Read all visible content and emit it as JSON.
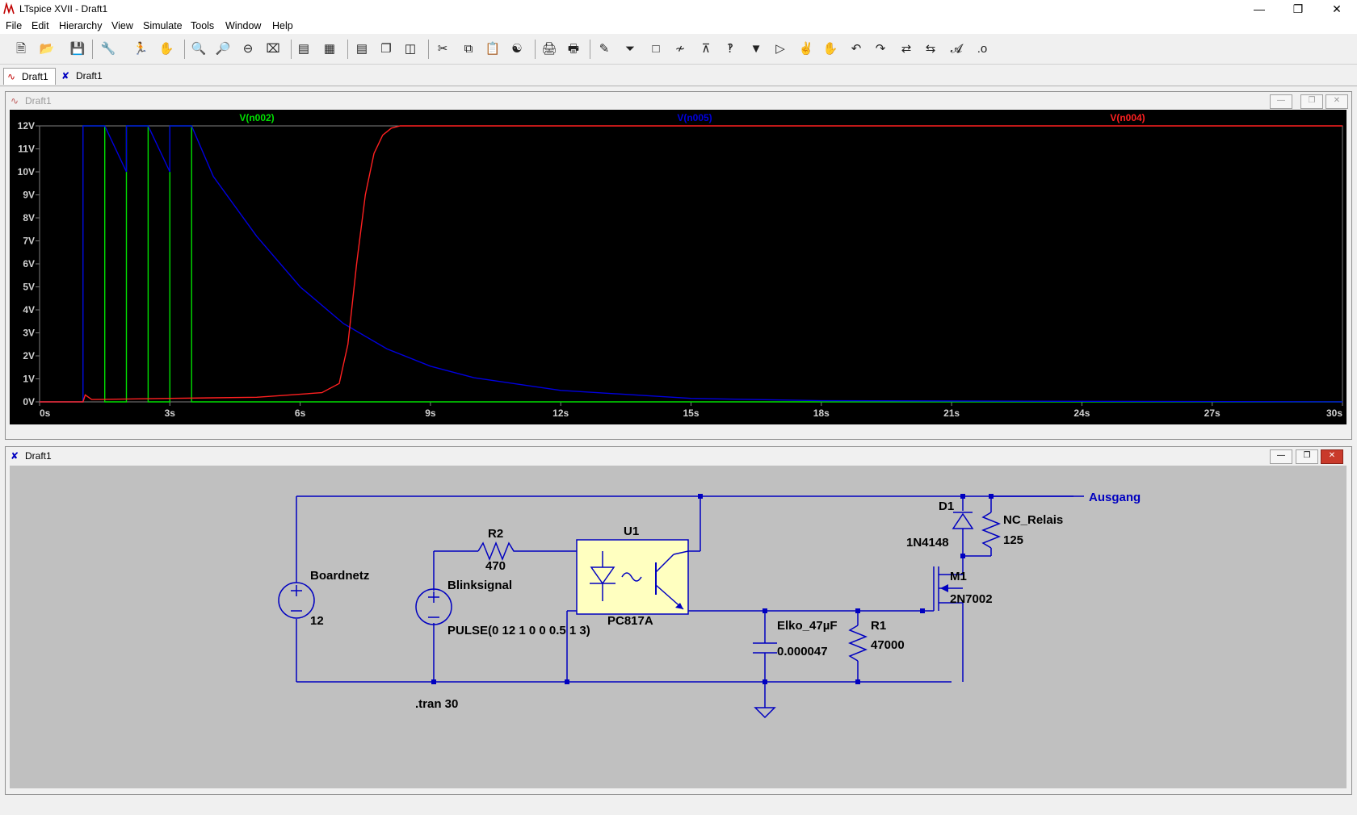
{
  "window": {
    "title": "LTspice XVII - Draft1"
  },
  "menu": [
    "File",
    "Edit",
    "Hierarchy",
    "View",
    "Simulate",
    "Tools",
    "Window",
    "Help"
  ],
  "tabs": [
    {
      "label": "Draft1"
    },
    {
      "label": "Draft1"
    }
  ],
  "waveform_window": {
    "title": "Draft1",
    "traces": [
      {
        "name": "V(n002)",
        "color": "#00e000"
      },
      {
        "name": "V(n005)",
        "color": "#0000e0"
      },
      {
        "name": "V(n004)",
        "color": "#ff2020"
      }
    ]
  },
  "chart_data": {
    "type": "line",
    "x_ticks": [
      "0s",
      "3s",
      "6s",
      "9s",
      "12s",
      "15s",
      "18s",
      "21s",
      "24s",
      "27s",
      "30s"
    ],
    "y_ticks": [
      "0V",
      "1V",
      "2V",
      "3V",
      "4V",
      "5V",
      "6V",
      "7V",
      "8V",
      "9V",
      "10V",
      "11V",
      "12V"
    ],
    "xlim": [
      0,
      30
    ],
    "ylim": [
      0,
      12
    ],
    "grid": false,
    "series": [
      {
        "name": "V(n002)",
        "color": "#00e000",
        "x": [
          0,
          1.0,
          1.0,
          1.5,
          1.5,
          2.0,
          2.0,
          2.5,
          2.5,
          3.0,
          3.0,
          3.5,
          3.5,
          30
        ],
        "y": [
          0,
          0,
          12,
          12,
          0,
          0,
          12,
          12,
          0,
          0,
          12,
          12,
          0,
          0
        ]
      },
      {
        "name": "V(n005)",
        "color": "#0000e0",
        "x": [
          0,
          1.0,
          1.0,
          1.5,
          2.0,
          2.0,
          2.5,
          3.0,
          3.0,
          3.5,
          4.0,
          5.0,
          6.0,
          7.0,
          8.0,
          9.0,
          10.0,
          12.0,
          15.0,
          18.0,
          30
        ],
        "y": [
          0,
          0,
          12,
          12,
          10.0,
          12,
          12,
          10.0,
          12,
          12,
          9.8,
          7.2,
          5.0,
          3.4,
          2.3,
          1.55,
          1.05,
          0.5,
          0.15,
          0.05,
          0
        ]
      },
      {
        "name": "V(n004)",
        "color": "#ff2020",
        "x": [
          0,
          1.0,
          1.05,
          1.2,
          3.0,
          5.0,
          6.5,
          6.9,
          7.1,
          7.3,
          7.5,
          7.7,
          7.9,
          8.1,
          8.3,
          30
        ],
        "y": [
          0,
          0,
          0.3,
          0.1,
          0.15,
          0.2,
          0.4,
          0.8,
          2.5,
          6.0,
          9.0,
          10.8,
          11.6,
          11.9,
          12,
          12
        ]
      }
    ]
  },
  "schematic_window": {
    "title": "Draft1",
    "labels": {
      "boardnetz_name": "Boardnetz",
      "boardnetz_value": "12",
      "blink_name": "Blinksignal",
      "blink_value": "PULSE(0 12 1 0 0 0.5 1 3)",
      "r2_name": "R2",
      "r2_value": "470",
      "u1_name": "U1",
      "u1_value": "PC817A",
      "elko_name": "Elko_47µF",
      "elko_value": "0.000047",
      "r1_name": "R1",
      "r1_value": "47000",
      "m1_name": "M1",
      "m1_value": "2N7002",
      "d1_name": "D1",
      "d1_value": "1N4148",
      "relais_name": "NC_Relais",
      "relais_value": "125",
      "net_ausgang": "Ausgang",
      "tran_directive": ".tran 30"
    }
  }
}
